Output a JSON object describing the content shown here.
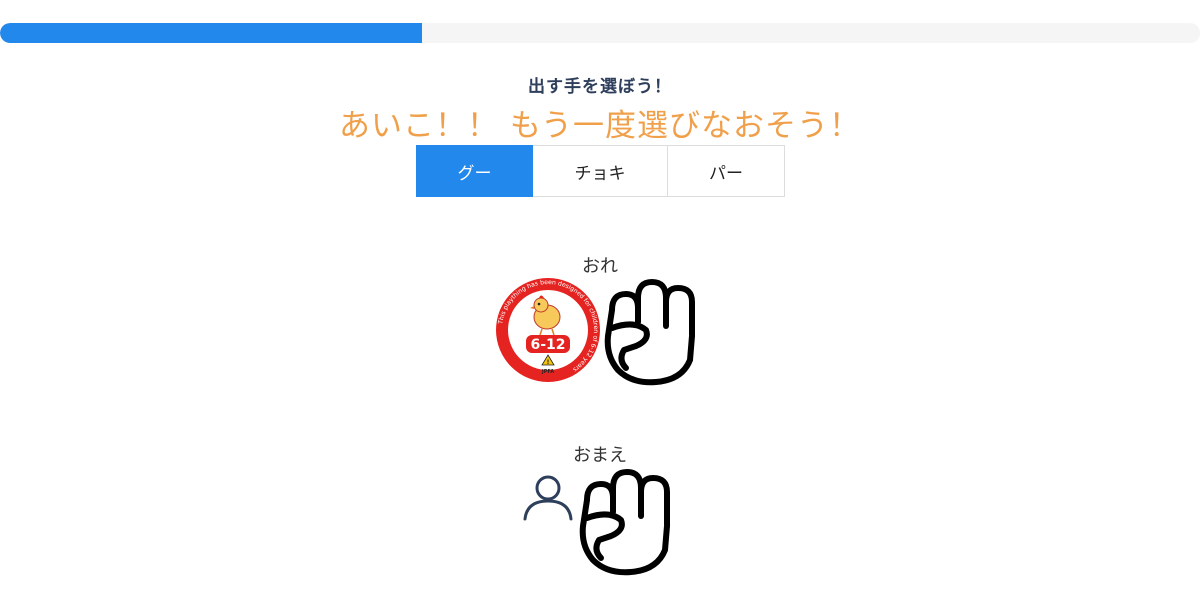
{
  "progress": {
    "fraction": 0.352
  },
  "instruction": "出す手を選ぼう！",
  "result_message": "あいこ！！ もう一度選びなおそう！",
  "choices": [
    {
      "label": "グー",
      "active": true
    },
    {
      "label": "チョキ",
      "active": false
    },
    {
      "label": "パー",
      "active": false
    }
  ],
  "cpu": {
    "label": "おれ",
    "badge": {
      "age_range": "6-12",
      "org": "JPFA",
      "ring_text": "This plaything has been designed for children of 6-12 years"
    },
    "hand": "rock-hand-icon"
  },
  "player": {
    "label": "おまえ",
    "avatar": "user-icon",
    "hand": "rock-hand-icon"
  },
  "colors": {
    "accent": "#2388ec",
    "result": "#f0a04b",
    "track": "#f5f5f5",
    "badge_red": "#e52320"
  }
}
